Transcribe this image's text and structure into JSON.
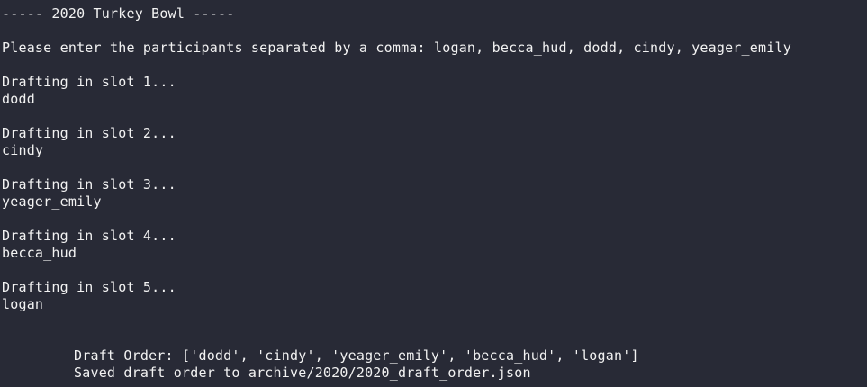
{
  "terminal": {
    "title": "----- 2020 Turkey Bowl -----",
    "prompt_label": "Please enter the participants separated by a comma: ",
    "prompt_input": "logan, becca_hud, dodd, cindy, yeager_emily",
    "slots": [
      {
        "heading": "Drafting in slot 1...",
        "pick": "dodd"
      },
      {
        "heading": "Drafting in slot 2...",
        "pick": "cindy"
      },
      {
        "heading": "Drafting in slot 3...",
        "pick": "yeager_emily"
      },
      {
        "heading": "Drafting in slot 4...",
        "pick": "becca_hud"
      },
      {
        "heading": "Drafting in slot 5...",
        "pick": "logan"
      }
    ],
    "draft_order": "Draft Order: ['dodd', 'cindy', 'yeager_emily', 'becca_hud', 'logan']",
    "saved_message": "Saved draft order to archive/2020/2020_draft_order.json"
  },
  "colors": {
    "background": "#282a36",
    "text": "#f2f2f2"
  }
}
